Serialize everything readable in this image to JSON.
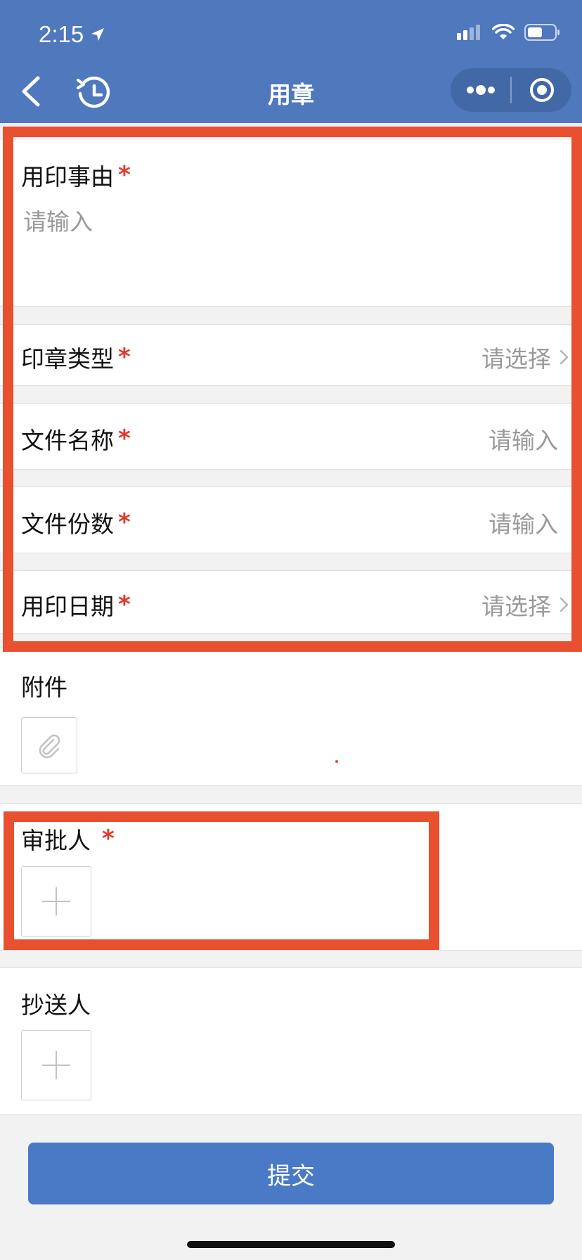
{
  "status_bar": {
    "time": "2:15"
  },
  "nav": {
    "title": "用章"
  },
  "form": {
    "reason": {
      "label": "用印事由",
      "required_mark": "*",
      "placeholder": "请输入"
    },
    "seal_type": {
      "label": "印章类型",
      "required_mark": "*",
      "placeholder": "请选择"
    },
    "file_name": {
      "label": "文件名称",
      "required_mark": "*",
      "placeholder": "请输入"
    },
    "file_count": {
      "label": "文件份数",
      "required_mark": "*",
      "placeholder": "请输入"
    },
    "seal_date": {
      "label": "用印日期",
      "required_mark": "*",
      "placeholder": "请选择"
    },
    "attachment": {
      "label": "附件"
    },
    "approver": {
      "label": "审批人",
      "required_mark": "*"
    },
    "cc": {
      "label": "抄送人"
    }
  },
  "submit": {
    "label": "提交"
  },
  "colors": {
    "header": "#4f78bd",
    "accent": "#4a79c6",
    "required": "#e1392d",
    "annotation": "#e8502f"
  },
  "icons": [
    "back-icon",
    "history-icon",
    "more-icon",
    "target-icon",
    "chevron-right-icon",
    "paperclip-icon",
    "plus-icon",
    "signal-icon",
    "wifi-icon",
    "battery-icon",
    "location-arrow-icon"
  ]
}
